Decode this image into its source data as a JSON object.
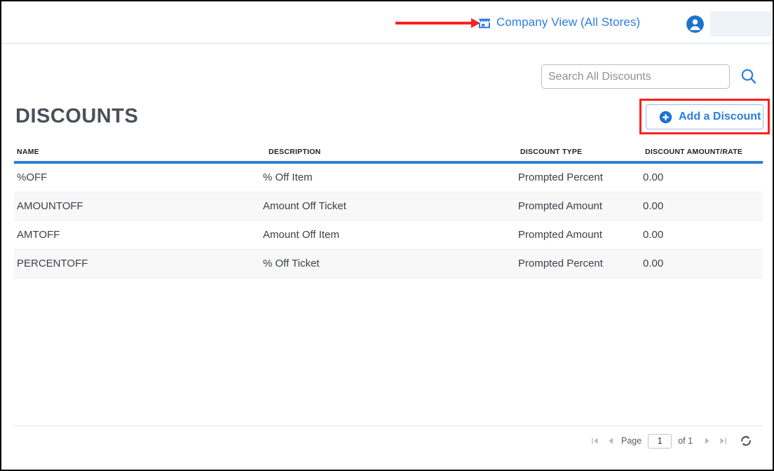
{
  "topbar": {
    "store_icon": "storefront-icon",
    "company_view_label": "Company View (All Stores)",
    "avatar_icon": "user-avatar-icon"
  },
  "search": {
    "placeholder": "Search All Discounts",
    "value": "",
    "icon": "search-icon"
  },
  "header": {
    "title": "DISCOUNTS"
  },
  "actions": {
    "add_discount_label": "Add a Discount",
    "add_icon": "plus-circle-icon"
  },
  "table": {
    "columns": [
      "NAME",
      "DESCRIPTION",
      "DISCOUNT TYPE",
      "DISCOUNT AMOUNT/RATE"
    ],
    "rows": [
      {
        "name": "%OFF",
        "description": "% Off Item",
        "type": "Prompted Percent",
        "amount": "0.00"
      },
      {
        "name": "AMOUNTOFF",
        "description": "Amount Off Ticket",
        "type": "Prompted Amount",
        "amount": "0.00"
      },
      {
        "name": "AMTOFF",
        "description": "Amount Off Item",
        "type": "Prompted Amount",
        "amount": "0.00"
      },
      {
        "name": "PERCENTOFF",
        "description": "% Off Ticket",
        "type": "Prompted Percent",
        "amount": "0.00"
      }
    ]
  },
  "pager": {
    "first_icon": "first-page-icon",
    "prev_icon": "previous-page-icon",
    "page_label": "Page",
    "page_value": "1",
    "of_label": "of 1",
    "next_icon": "next-page-icon",
    "last_icon": "last-page-icon",
    "refresh_icon": "refresh-icon"
  },
  "colors": {
    "accent_blue": "#2b7de0",
    "table_rule_blue": "#2e7ed6",
    "annotation_red": "#fc2020",
    "alt_row": "#f8f8f9"
  }
}
